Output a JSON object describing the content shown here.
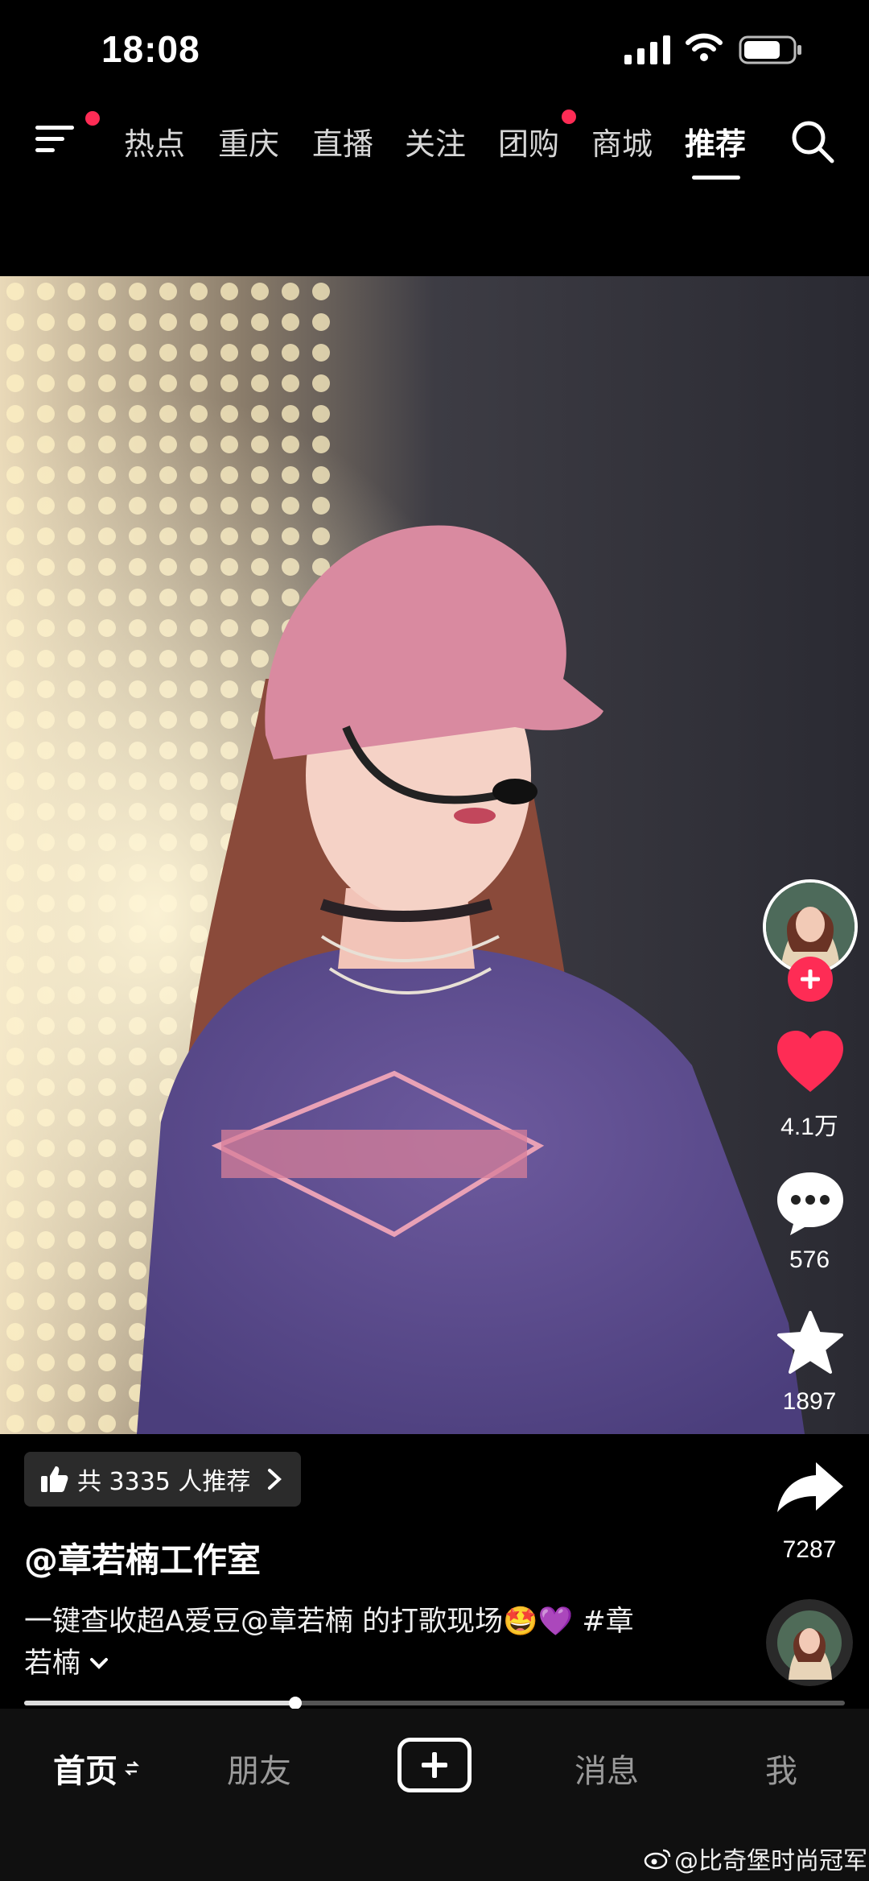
{
  "status_bar": {
    "time": "18:08"
  },
  "top_nav": {
    "tabs": [
      {
        "label": "热点"
      },
      {
        "label": "重庆"
      },
      {
        "label": "直播"
      },
      {
        "label": "关注"
      },
      {
        "label": "团购"
      },
      {
        "label": "商城"
      },
      {
        "label": "推荐"
      }
    ],
    "active_tab": "推荐"
  },
  "right_rail": {
    "likes": "4.1万",
    "comments": "576",
    "favorites": "1897",
    "shares": "7287"
  },
  "video_info": {
    "recommend_chip": "共 3335 人推荐",
    "author": "@章若楠工作室",
    "caption_line1": "一键查收超A爱豆@章若楠  的打歌现场🤩💜 #章",
    "caption_line2": "若楠",
    "progress": 0.33
  },
  "bottom_nav": {
    "tabs": [
      {
        "label": "首页"
      },
      {
        "label": "朋友"
      },
      {
        "label": "消息"
      },
      {
        "label": "我"
      }
    ],
    "active_tab": "首页"
  },
  "watermark": "@比奇堡时尚冠军",
  "colors": {
    "accent": "#fe2c55",
    "like": "#fe2c55",
    "background": "#000000"
  }
}
